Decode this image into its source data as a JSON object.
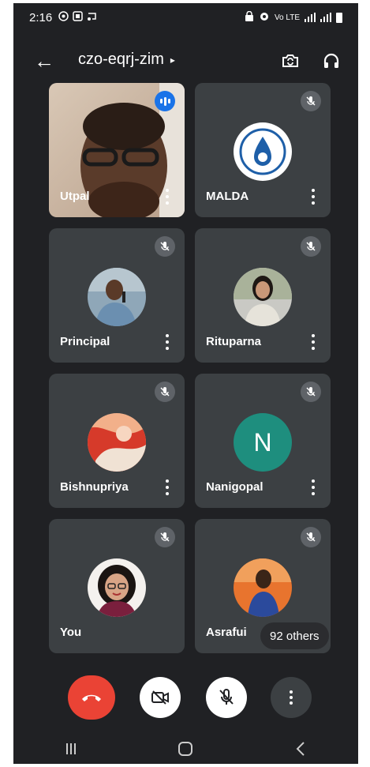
{
  "status_bar": {
    "time": "2:16",
    "network_label": "Vo LTE"
  },
  "header": {
    "meeting_code": "czo-eqrj-zim",
    "caret": "▸",
    "back_glyph": "←"
  },
  "participants": [
    {
      "name": "Utpal",
      "type": "video",
      "speaking": true
    },
    {
      "name": "MALDA",
      "type": "logo",
      "muted": true
    },
    {
      "name": "Principal",
      "type": "photo",
      "muted": true
    },
    {
      "name": "Rituparna",
      "type": "photo",
      "muted": true
    },
    {
      "name": "Bishnupriya",
      "type": "photo",
      "muted": true
    },
    {
      "name": "Nanigopal",
      "type": "letter",
      "letter": "N",
      "color": "#1e8e7e",
      "muted": true
    },
    {
      "name": "You",
      "type": "photo",
      "muted": true
    },
    {
      "name": "Asrafui",
      "type": "photo",
      "muted": true
    }
  ],
  "others_badge": "92 others",
  "colors": {
    "background": "#202124",
    "tile": "#3c4043",
    "hangup": "#ea4335",
    "speaking": "#1a73e8",
    "letter_avatar": "#1e8e7e"
  },
  "icons": {
    "back": "arrow-left-icon",
    "switch_camera": "switch-camera-icon",
    "audio_output": "headphones-icon",
    "hangup": "hangup-icon",
    "camera_off": "camera-off-icon",
    "mic_off": "mic-off-icon",
    "more": "more-vert-icon"
  }
}
